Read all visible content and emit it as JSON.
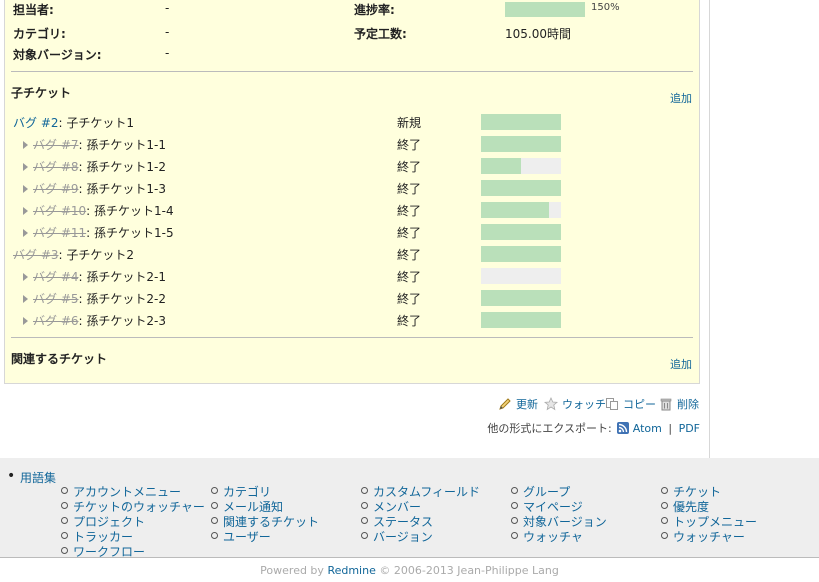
{
  "attributes": {
    "assignee_label": "担当者:",
    "assignee_value": "-",
    "category_label": "カテゴリ:",
    "category_value": "-",
    "version_label": "対象バージョン:",
    "version_value": "-",
    "progress_label": "進捗率:",
    "progress_text": "150%",
    "progress_fill": 100,
    "estimated_label": "予定工数:",
    "estimated_value": "105.00時間"
  },
  "subtasks": {
    "title": "子チケット",
    "add_label": "追加",
    "rows": [
      {
        "link": "バグ #2",
        "subject": ": 子チケット1",
        "status": "新規",
        "progress": 100,
        "closed": false,
        "indent": 0
      },
      {
        "link": "バグ #7",
        "subject": ": 孫チケット1-1",
        "status": "終了",
        "progress": 100,
        "closed": true,
        "indent": 1
      },
      {
        "link": "バグ #8",
        "subject": ": 孫チケット1-2",
        "status": "終了",
        "progress": 50,
        "closed": true,
        "indent": 1
      },
      {
        "link": "バグ #9",
        "subject": ": 孫チケット1-3",
        "status": "終了",
        "progress": 100,
        "closed": true,
        "indent": 1
      },
      {
        "link": "バグ #10",
        "subject": ": 孫チケット1-4",
        "status": "終了",
        "progress": 85,
        "closed": true,
        "indent": 1
      },
      {
        "link": "バグ #11",
        "subject": ": 孫チケット1-5",
        "status": "終了",
        "progress": 100,
        "closed": true,
        "indent": 1
      },
      {
        "link": "バグ #3",
        "subject": ": 子チケット2",
        "status": "終了",
        "progress": 100,
        "closed": true,
        "indent": 0
      },
      {
        "link": "バグ #4",
        "subject": ": 孫チケット2-1",
        "status": "終了",
        "progress": 0,
        "closed": true,
        "indent": 1
      },
      {
        "link": "バグ #5",
        "subject": ": 孫チケット2-2",
        "status": "終了",
        "progress": 100,
        "closed": true,
        "indent": 1
      },
      {
        "link": "バグ #6",
        "subject": ": 孫チケット2-3",
        "status": "終了",
        "progress": 100,
        "closed": true,
        "indent": 1
      }
    ]
  },
  "relations": {
    "title": "関連するチケット",
    "add_label": "追加"
  },
  "contextual": {
    "edit": "更新",
    "watch": "ウォッチ",
    "copy": "コピー",
    "delete": "削除"
  },
  "export": {
    "label": "他の形式にエクスポート:",
    "atom": "Atom",
    "separator": "|",
    "pdf": "PDF"
  },
  "sitemap": {
    "root": "用語集",
    "columns": [
      [
        "アカウントメニュー",
        "チケットのウォッチャー",
        "プロジェクト",
        "トラッカー",
        "ワークフロー"
      ],
      [
        "カテゴリ",
        "メール通知",
        "関連するチケット",
        "ユーザー"
      ],
      [
        "カスタムフィールド",
        "メンバー",
        "ステータス",
        "バージョン"
      ],
      [
        "グループ",
        "マイページ",
        "対象バージョン",
        "ウォッチャ"
      ],
      [
        "チケット",
        "優先度",
        "トップメニュー",
        "ウォッチャー"
      ]
    ]
  },
  "footer": {
    "powered_prefix": "Powered by ",
    "redmine": "Redmine",
    "copyright": " © 2006-2013 Jean-Philippe Lang"
  },
  "colors": {
    "link": "#116699",
    "progress_fill": "#bae0ba",
    "progress_empty": "#eeeeee",
    "box_bg": "#ffffdd"
  }
}
